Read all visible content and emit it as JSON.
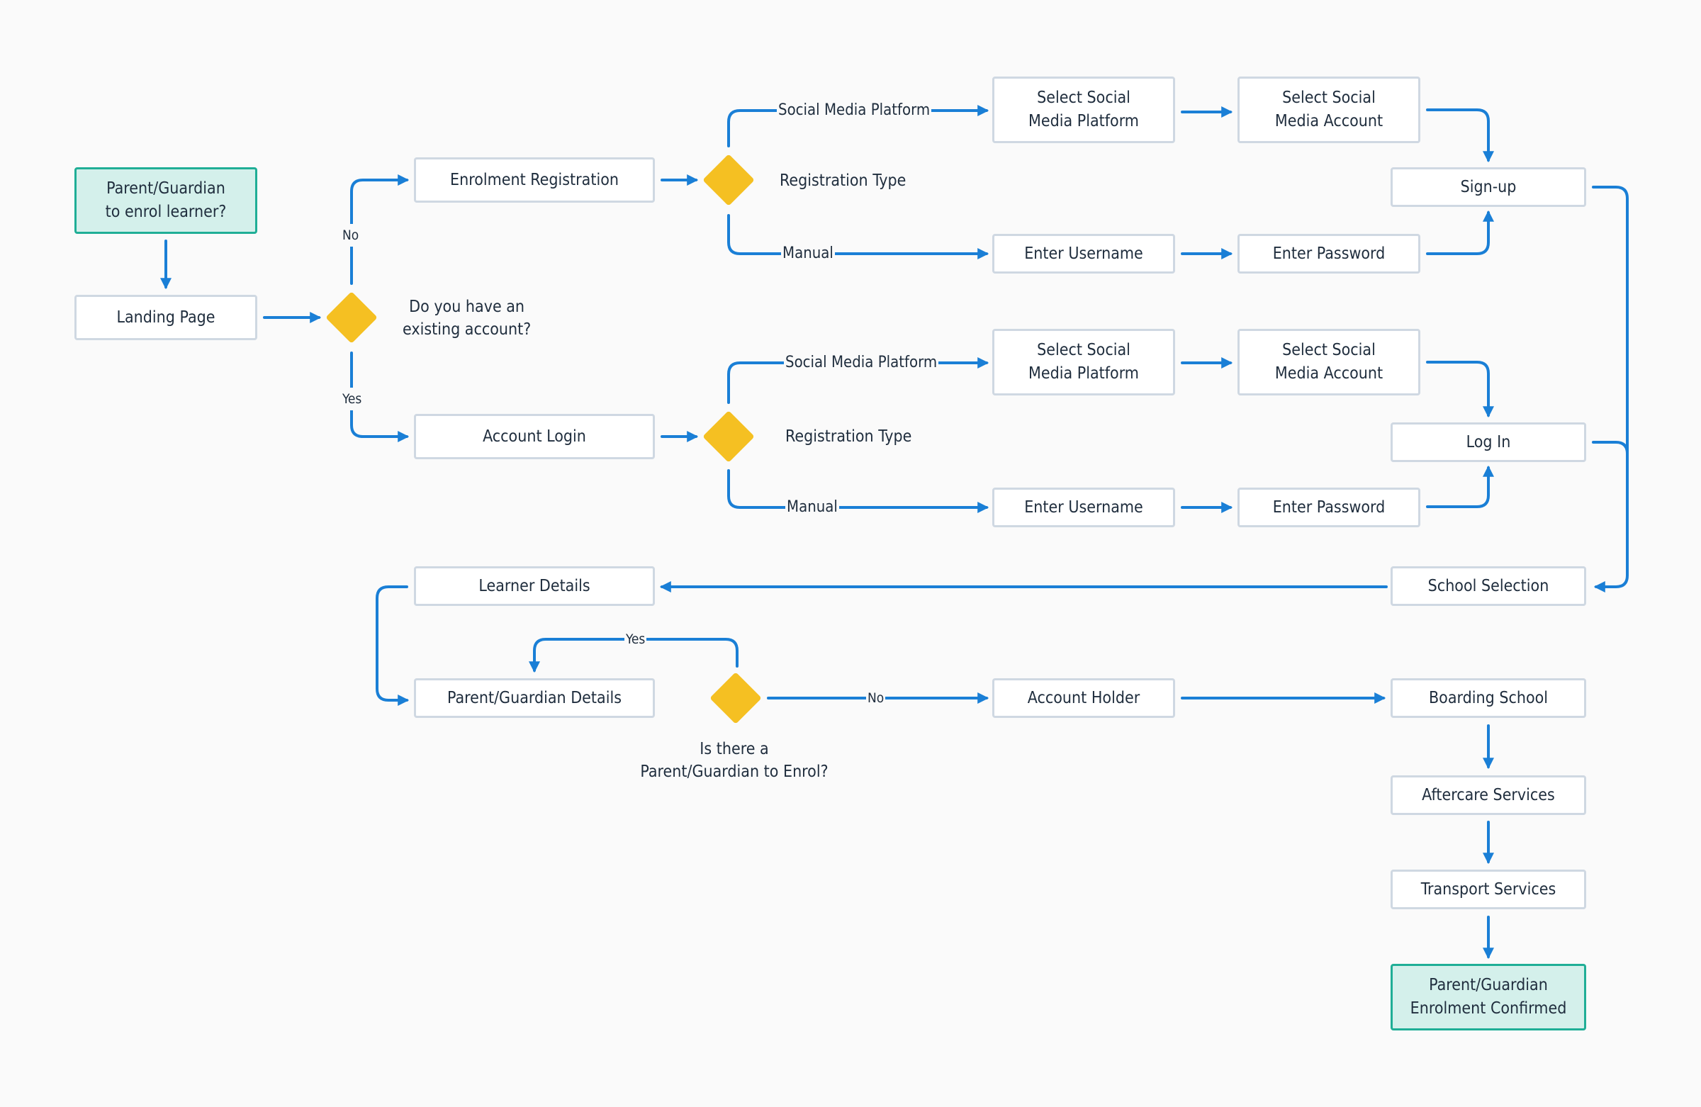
{
  "diagram": {
    "type": "flowchart",
    "colors": {
      "edge": "#1a7fd6",
      "decision": "#f5c022",
      "terminal_fill": "#d4f0eb",
      "terminal_border": "#1fae96",
      "node_border": "#cfd8e2"
    },
    "nodes": {
      "start": "Parent/Guardian\nto enrol learner?",
      "landing": "Landing Page",
      "enrol_reg": "Enrolment Registration",
      "account_login": "Account Login",
      "r_social_platform": "Select Social\nMedia Platform",
      "r_social_account": "Select Social\nMedia Account",
      "r_username": "Enter Username",
      "r_password": "Enter Password",
      "signup": "Sign-up",
      "l_social_platform": "Select Social\nMedia Platform",
      "l_social_account": "Select Social\nMedia Account",
      "l_username": "Enter Username",
      "l_password": "Enter Password",
      "login": "Log In",
      "school_selection": "School Selection",
      "learner_details": "Learner Details",
      "pg_details": "Parent/Guardian Details",
      "account_holder": "Account Holder",
      "boarding": "Boarding School",
      "aftercare": "Aftercare Services",
      "transport": "Transport Services",
      "end": "Parent/Guardian\nEnrolment Confirmed"
    },
    "decisions": {
      "existing_account": "Do you have an\nexisting account?",
      "reg_type_1": "Registration Type",
      "reg_type_2": "Registration Type",
      "pg_to_enrol": "Is there a\nParent/Guardian to Enrol?"
    },
    "edge_labels": {
      "no": "No",
      "yes": "Yes",
      "social_1": "Social Media Platform",
      "manual_1": "Manual",
      "social_2": "Social Media Platform",
      "manual_2": "Manual",
      "pg_yes": "Yes",
      "pg_no": "No"
    }
  }
}
